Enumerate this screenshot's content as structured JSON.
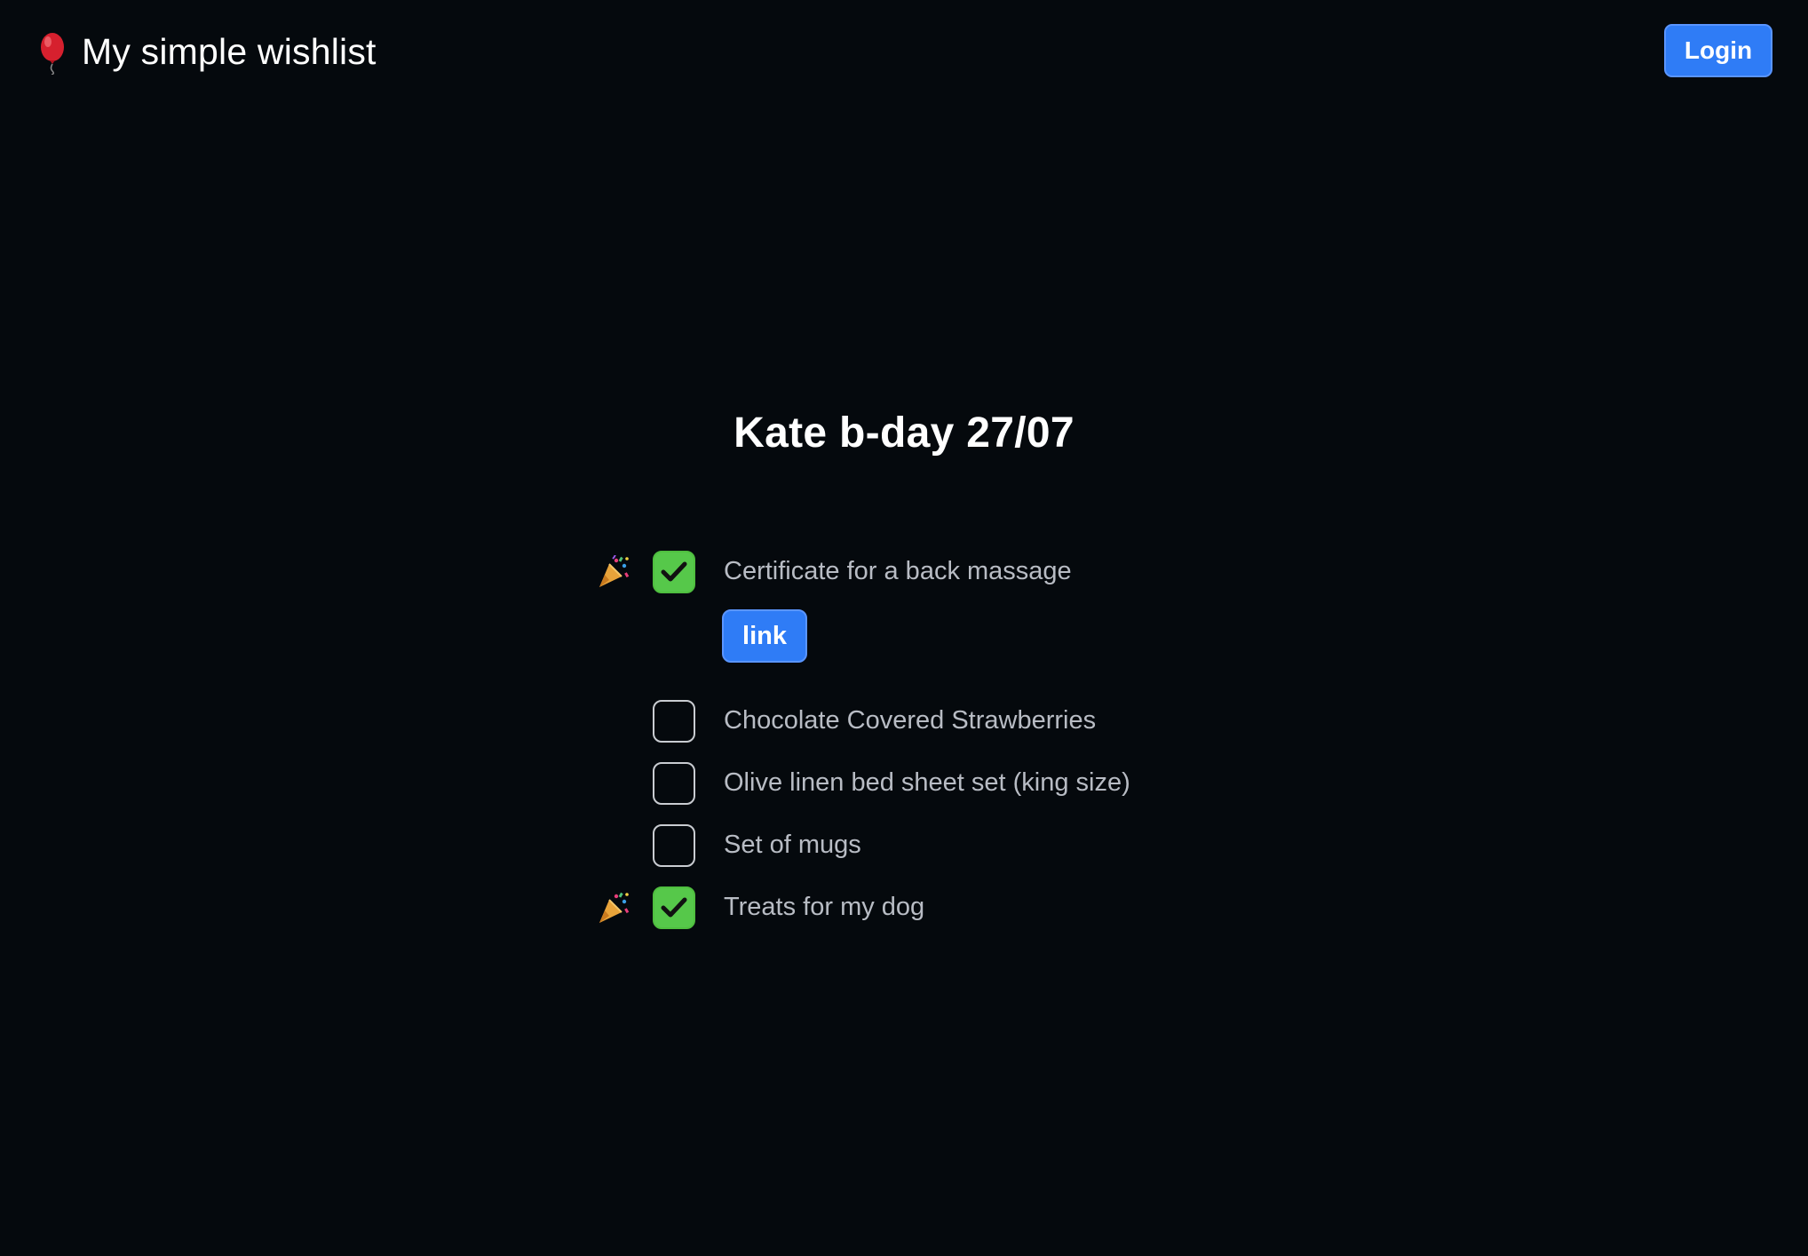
{
  "header": {
    "app_icon": "balloon-icon",
    "app_title": "My simple wishlist",
    "login_label": "Login"
  },
  "wishlist": {
    "title": "Kate b-day 27/07",
    "items": [
      {
        "label": "Certificate for a back massage",
        "checked": true,
        "celebrate_icon": "party-popper-icon",
        "link_label": "link"
      },
      {
        "label": "Chocolate Covered Strawberries",
        "checked": false
      },
      {
        "label": "Olive linen bed sheet set (king size)",
        "checked": false
      },
      {
        "label": "Set of mugs",
        "checked": false
      },
      {
        "label": "Treats for my dog",
        "checked": true,
        "celebrate_icon": "party-popper-icon"
      }
    ]
  },
  "colors": {
    "background": "#05090d",
    "accent_blue": "#2f7cf6",
    "checked_green": "#56c84a",
    "item_text": "#b8bcc4"
  }
}
